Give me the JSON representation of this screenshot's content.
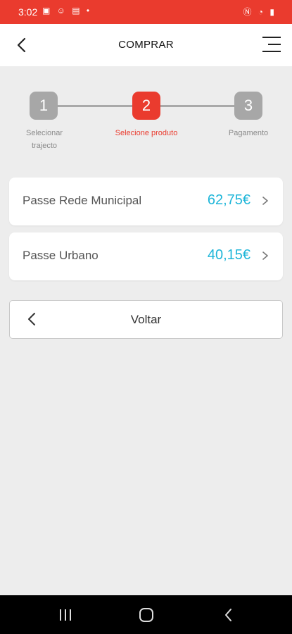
{
  "status_bar": {
    "time": "3:02",
    "left_icons": "▣ ☺ ▤ •",
    "right_icons": "Ⓝ ◔ ▮"
  },
  "header": {
    "title": "COMPRAR",
    "back_icon": "chevron-left-icon",
    "menu_icon": "hamburger-menu-icon"
  },
  "stepper": {
    "steps": [
      {
        "number": "1",
        "label_line1": "Selecionar",
        "label_line2": "trajecto",
        "active": false
      },
      {
        "number": "2",
        "label_line1": "Selecione produto",
        "label_line2": "",
        "active": true
      },
      {
        "number": "3",
        "label_line1": "Pagamento",
        "label_line2": "",
        "active": false
      }
    ]
  },
  "products": [
    {
      "name": "Passe Rede Municipal",
      "price": "62,75€"
    },
    {
      "name": "Passe Urbano",
      "price": "40,15€"
    }
  ],
  "back_button": {
    "label": "Voltar"
  },
  "colors": {
    "accent": "#ea3b2e",
    "price": "#1fb6d9",
    "inactive_step": "#a7a7a7",
    "background": "#ededed"
  }
}
